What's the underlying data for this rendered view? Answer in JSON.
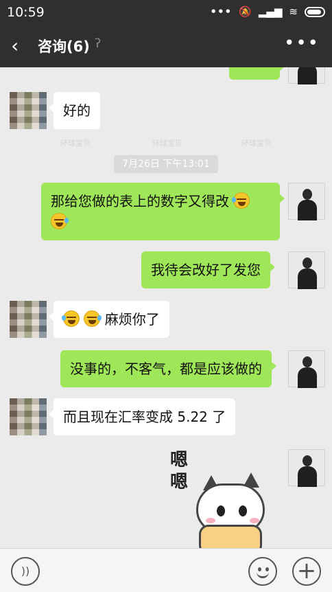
{
  "status_bar": {
    "time": "10:59"
  },
  "nav": {
    "title": "咨询(6)"
  },
  "messages": {
    "m1": "好的",
    "m2": "那给您做的表上的数字又得改",
    "m3": "我待会改好了发您",
    "m4": "麻烦你了",
    "m5": "没事的，不客气，都是应该做的",
    "m6": "而且现在汇率变成 5.22 了"
  },
  "timestamp": "7月26日 下午13:01",
  "sticker": {
    "text": "嗯嗯"
  },
  "watermark": {
    "text": "环球宝贝"
  },
  "colors": {
    "nav_bg": "#2f2f2f",
    "out_bubble": "#9fe658",
    "in_bubble": "#ffffff",
    "chat_bg": "#ebebeb"
  },
  "icons": [
    "back-chevron-icon",
    "ear-icon",
    "more-dots-icon",
    "voice-icon",
    "emoji-icon",
    "plus-icon"
  ]
}
